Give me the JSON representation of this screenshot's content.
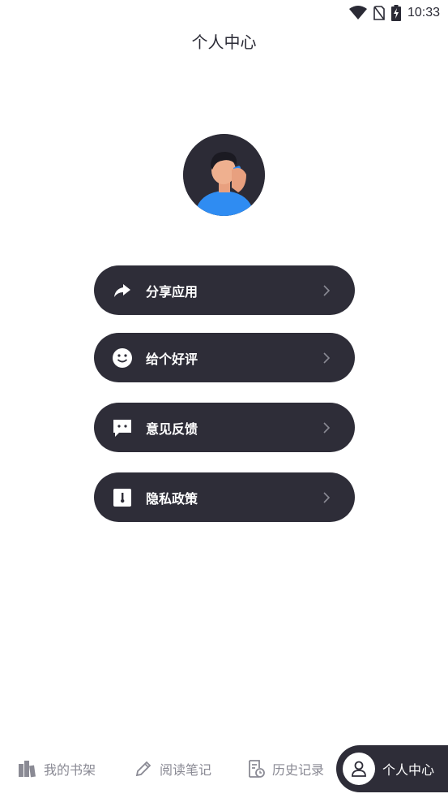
{
  "status_bar": {
    "time": "10:33",
    "icons": [
      "wifi-icon",
      "no-sim-icon",
      "battery-charging-icon"
    ]
  },
  "header": {
    "title": "个人中心"
  },
  "profile": {
    "avatar": "user-avatar-icon"
  },
  "menu": [
    {
      "label": "分享应用",
      "icon": "share-icon"
    },
    {
      "label": "给个好评",
      "icon": "smiley-icon"
    },
    {
      "label": "意见反馈",
      "icon": "feedback-icon"
    },
    {
      "label": "隐私政策",
      "icon": "privacy-icon"
    }
  ],
  "tabs": [
    {
      "label": "我的书架",
      "icon": "bookshelf-icon"
    },
    {
      "label": "阅读笔记",
      "icon": "pencil-icon"
    },
    {
      "label": "历史记录",
      "icon": "history-icon"
    },
    {
      "label": "个人中心",
      "icon": "person-icon",
      "active": true
    }
  ],
  "colors": {
    "dark": "#2e2d38",
    "accent_blue": "#2f8cf2",
    "text_gray": "#8a8a94"
  }
}
